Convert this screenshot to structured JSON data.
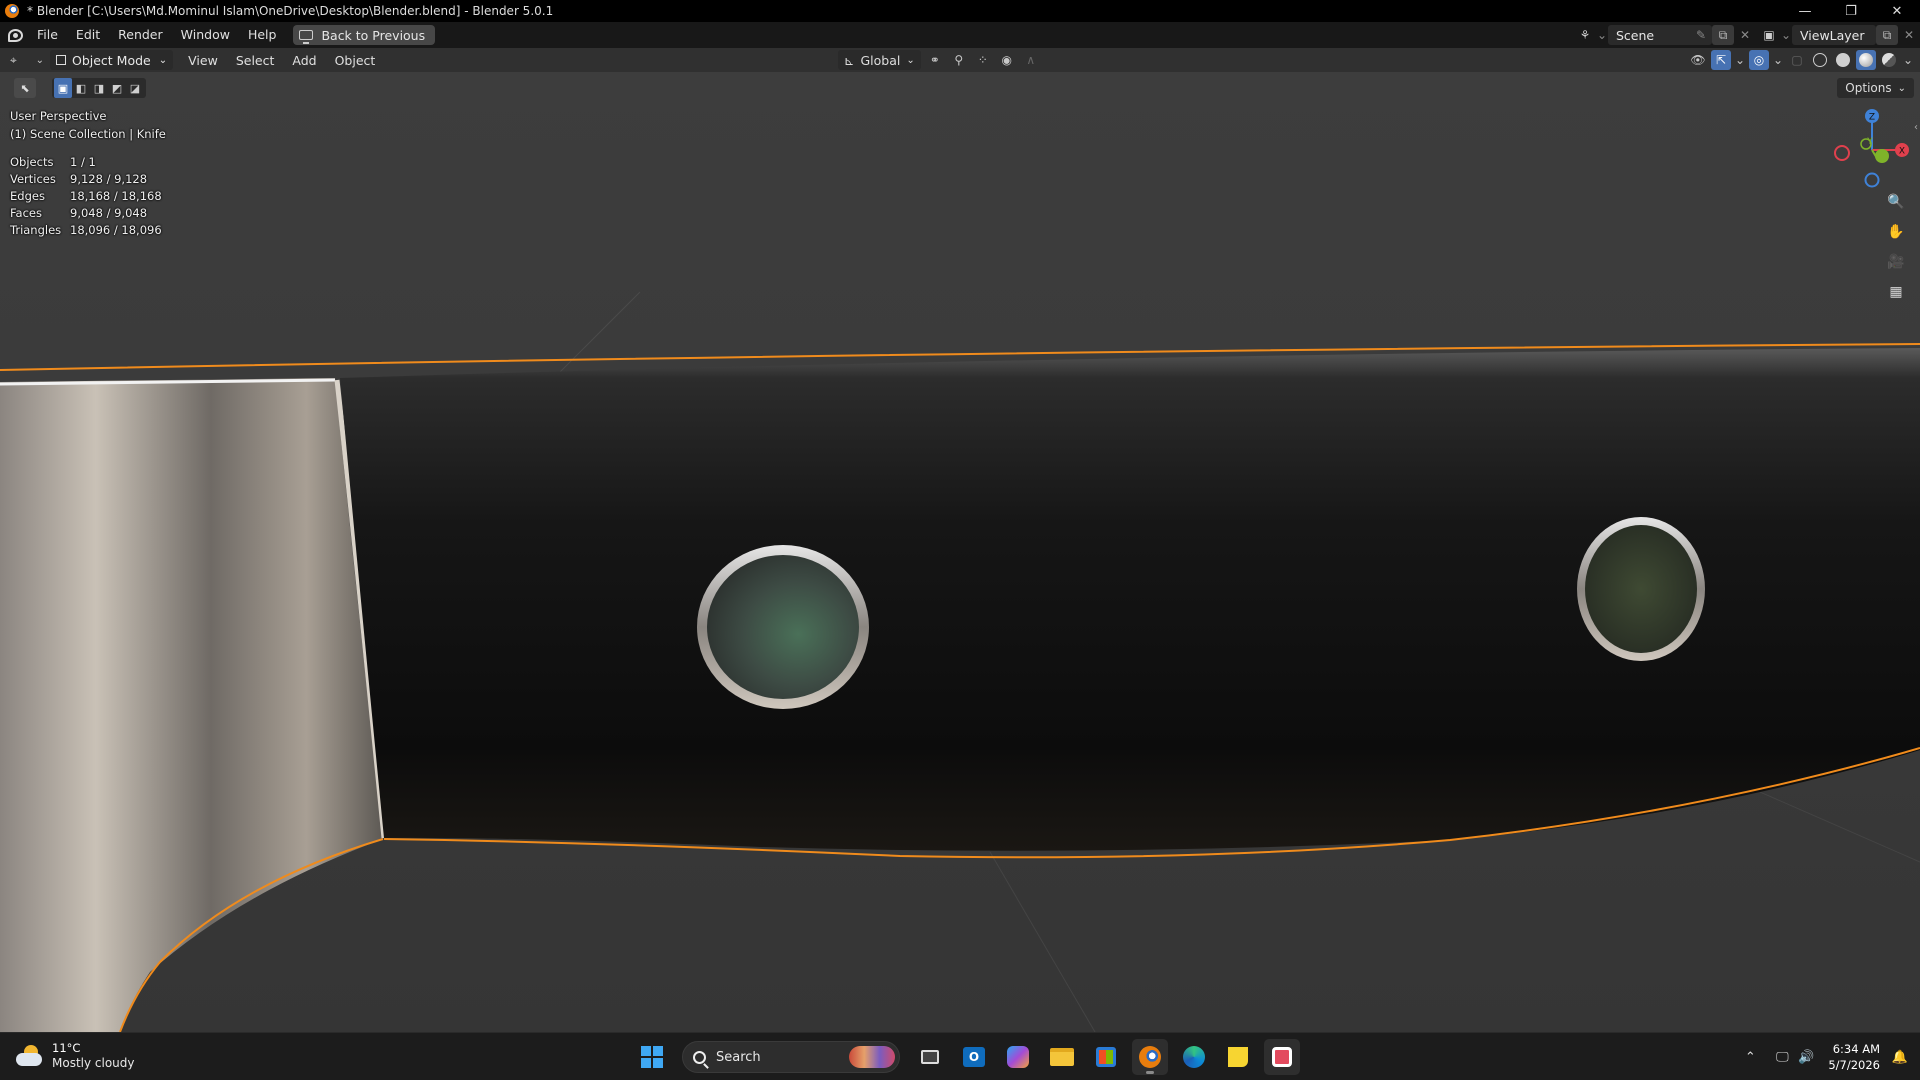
{
  "window": {
    "title": "* Blender [C:\\Users\\Md.Mominul Islam\\OneDrive\\Desktop\\Blender.blend] - Blender 5.0.1",
    "controls": [
      "—",
      "❐",
      "✕"
    ]
  },
  "menubar": {
    "items": [
      "File",
      "Edit",
      "Render",
      "Window",
      "Help"
    ],
    "back_button": "Back to Previous",
    "scene": "Scene",
    "view_layer": "ViewLayer"
  },
  "viewport_header": {
    "mode": "Object Mode",
    "menus": [
      "View",
      "Select",
      "Add",
      "Object"
    ],
    "transform_orientation": "Global"
  },
  "viewport": {
    "options_label": "Options",
    "perspective": "User Perspective",
    "collection": "(1) Scene Collection | Knife",
    "stats": [
      {
        "label": "Objects",
        "value": "1 / 1"
      },
      {
        "label": "Vertices",
        "value": "9,128 / 9,128"
      },
      {
        "label": "Edges",
        "value": "18,168 / 18,168"
      },
      {
        "label": "Faces",
        "value": "9,048 / 9,048"
      },
      {
        "label": "Triangles",
        "value": "18,096 / 18,096"
      }
    ],
    "gizmo_axes": {
      "z": "Z",
      "y": "Y",
      "x": "X"
    },
    "colors": {
      "selection_outline": "#f08b1c",
      "axis_x": "#e0404d",
      "axis_y": "#7fb32a",
      "axis_z": "#3f82d8"
    }
  },
  "taskbar": {
    "weather_temp": "11°C",
    "weather_condition": "Mostly cloudy",
    "search_placeholder": "Search",
    "time": "6:34 AM",
    "date": "5/7/2026"
  }
}
